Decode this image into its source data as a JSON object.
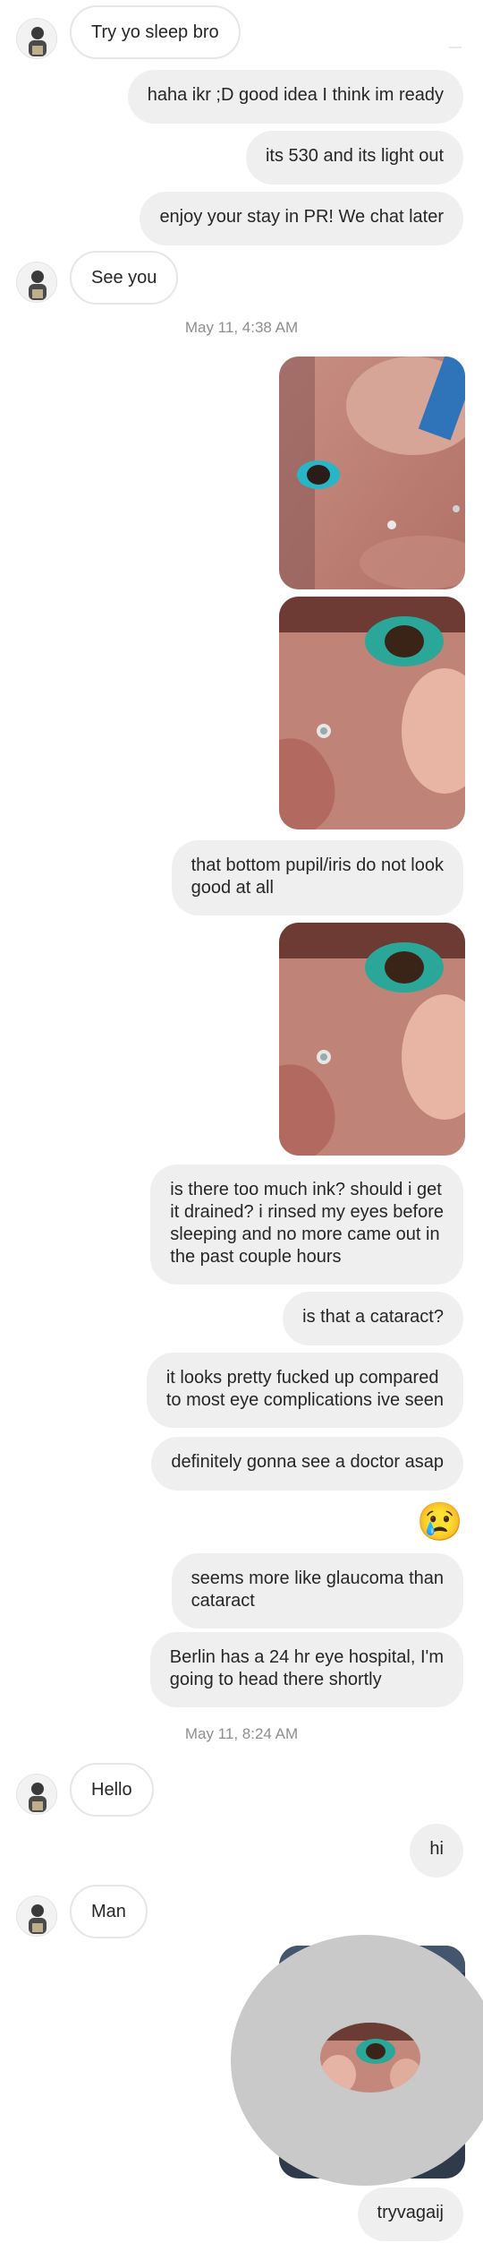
{
  "messages": {
    "m1": "Try yo sleep bro",
    "m2": "haha ikr ;D good idea I think im ready",
    "m3": "its 530 and its light out",
    "m4": "enjoy your stay in PR! We chat later",
    "m5": "See you",
    "ts1": "May 11, 4:38 AM",
    "m6": "that bottom pupil/iris do not look\ngood at all",
    "m7": "is there too much ink? should i get\nit drained? i rinsed my eyes before\nsleeping and no more came out in\nthe past couple hours",
    "m8": "is that a cataract?",
    "m9": "it looks pretty fucked up compared\nto most eye complications ive seen",
    "m10": "definitely gonna see a doctor asap",
    "emoji": "😢",
    "m11": "seems more like glaucoma than\ncataract",
    "m12": "Berlin has a 24 hr eye hospital, I'm\ngoing to head there shortly",
    "ts2": "May 11, 8:24 AM",
    "m13": "Hello",
    "m14": "hi",
    "m15": "Man",
    "m16": "tryvagaij"
  },
  "icons": {
    "avatar": "avatar-icon"
  },
  "colors": {
    "incoming_border": "#e6e6e6",
    "outgoing_bg": "#efefef",
    "timestamp": "#8e8e8e"
  }
}
